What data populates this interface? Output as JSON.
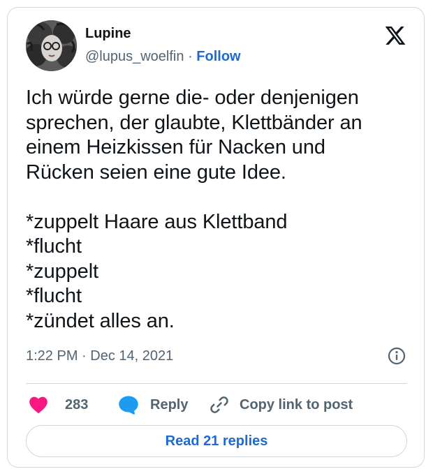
{
  "author": {
    "display_name": "Lupine",
    "handle": "@lupus_woelfin",
    "separator": "·",
    "follow_label": "Follow"
  },
  "tweet": {
    "text": "Ich würde gerne die- oder denjenigen\nsprechen, der glaubte, Klettbänder an\neinem Heizkissen für Nacken und\nRücken seien eine gute Idee.\n\n*zuppelt Haare aus Klettband\n*flucht\n*zuppelt\n*flucht\n*zündet alles an.",
    "timestamp": "1:22 PM · Dec 14, 2021"
  },
  "actions": {
    "likes_count": "283",
    "reply_label": "Reply",
    "copy_link_label": "Copy link to post"
  },
  "read_replies_label": "Read 21 replies",
  "icons": {
    "brand": "x-logo-icon",
    "info": "info-icon",
    "like": "heart-icon",
    "reply": "reply-bubble-icon",
    "copy": "link-icon"
  },
  "colors": {
    "like": "#f91880",
    "reply": "#1d9bf0",
    "link": "#1d6ad0",
    "secondary_text": "#536471",
    "border": "#cfd9de"
  }
}
